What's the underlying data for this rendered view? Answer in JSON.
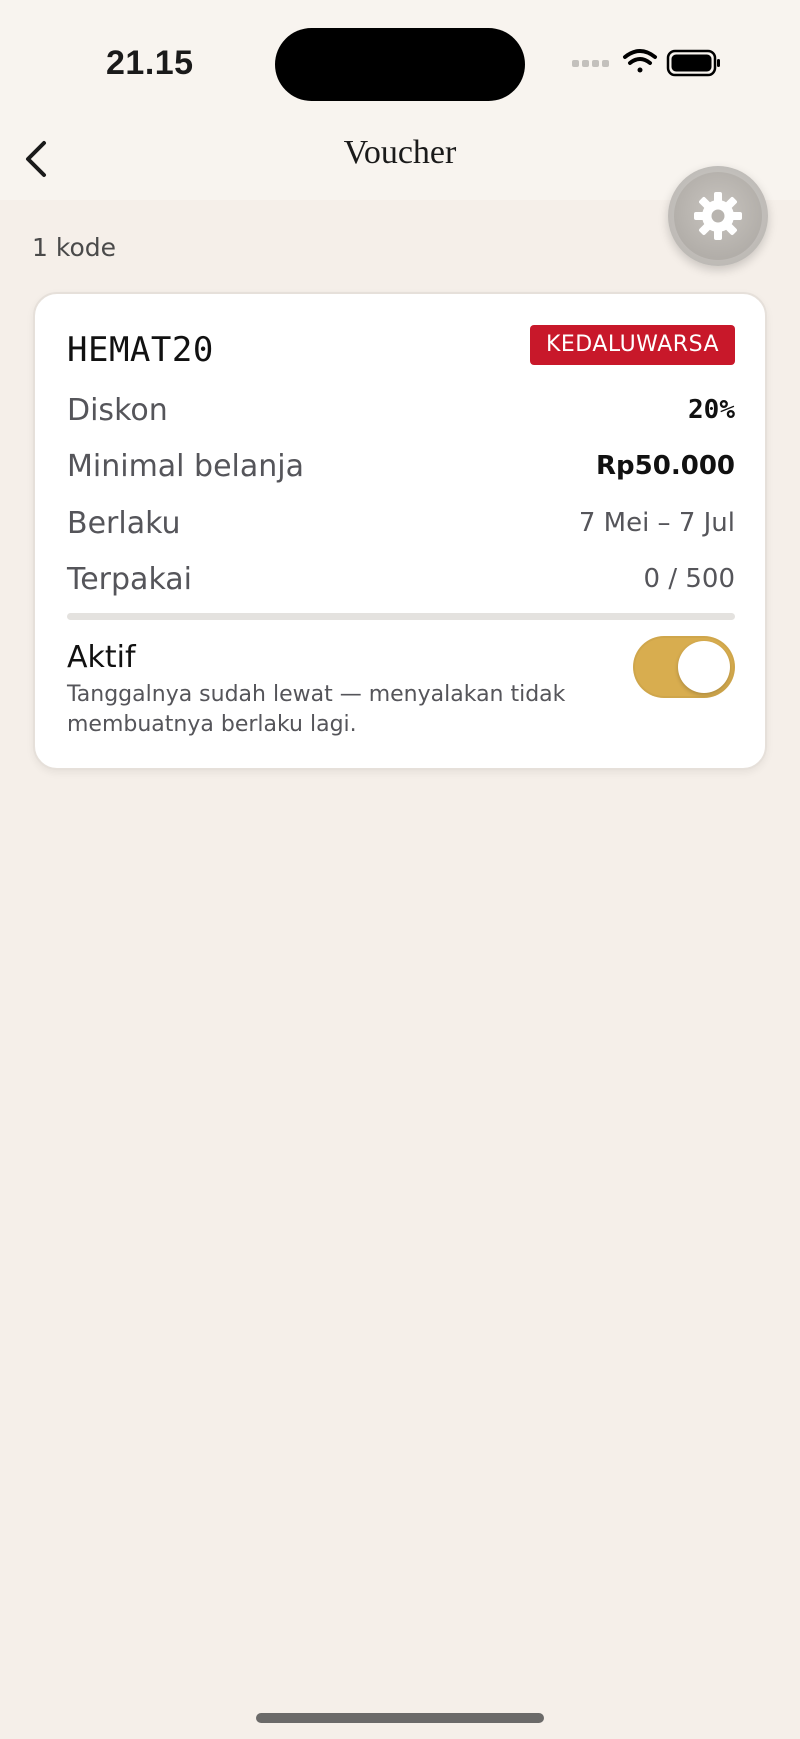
{
  "status_bar": {
    "time": "21.15"
  },
  "nav": {
    "title": "Voucher"
  },
  "summary": {
    "count_label": "1 kode"
  },
  "voucher": {
    "code": "HEMAT20",
    "status_badge": "KEDALUWARSA",
    "rows": [
      {
        "label": "Diskon",
        "value": "20%"
      },
      {
        "label": "Minimal belanja",
        "value": "Rp50.000"
      },
      {
        "label": "Berlaku",
        "value": "7 Mei – 7 Jul"
      },
      {
        "label": "Terpakai",
        "value": "0 / 500"
      }
    ],
    "usage_fraction": 0,
    "active_label": "Aktif",
    "active_note": "Tanggalnya sudah lewat — menyalakan tidak membuatnya berlaku lagi.",
    "active_on": true
  },
  "colors": {
    "background": "#f5efe9",
    "badge": "#c8182a",
    "toggle_on": "#d8ad4f"
  },
  "icons": {
    "back": "chevron-left-icon",
    "settings": "gear-icon",
    "wifi": "wifi-icon",
    "battery": "battery-icon",
    "signal": "signal-icon"
  }
}
